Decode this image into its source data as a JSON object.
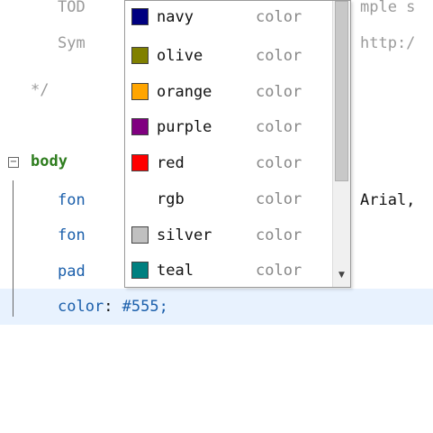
{
  "editor": {
    "lines": [
      {
        "left": "TOD",
        "right": "mple s"
      },
      {
        "left": "Sym",
        "right": "http:/"
      },
      {
        "left": "*/"
      },
      {
        "selector": "body"
      },
      {
        "prop": "fon",
        "right": "Arial,"
      },
      {
        "prop": "fon"
      },
      {
        "prop": "pad"
      },
      {
        "prop": "color",
        "sep": ": ",
        "value": "#555;"
      }
    ],
    "fold_symbol": "−"
  },
  "autocomplete": {
    "items": [
      {
        "name": "navy",
        "kind": "color",
        "swatch": "#000080"
      },
      {
        "name": "olive",
        "kind": "color",
        "swatch": "#808000"
      },
      {
        "name": "orange",
        "kind": "color",
        "swatch": "#ffa500"
      },
      {
        "name": "purple",
        "kind": "color",
        "swatch": "#800080"
      },
      {
        "name": "red",
        "kind": "color",
        "swatch": "#ff0000"
      },
      {
        "name": "rgb",
        "kind": "color",
        "swatch": ""
      },
      {
        "name": "silver",
        "kind": "color",
        "swatch": "#c0c0c0"
      },
      {
        "name": "teal",
        "kind": "color",
        "swatch": "#008080"
      }
    ],
    "scroll_down_icon": "▼"
  }
}
